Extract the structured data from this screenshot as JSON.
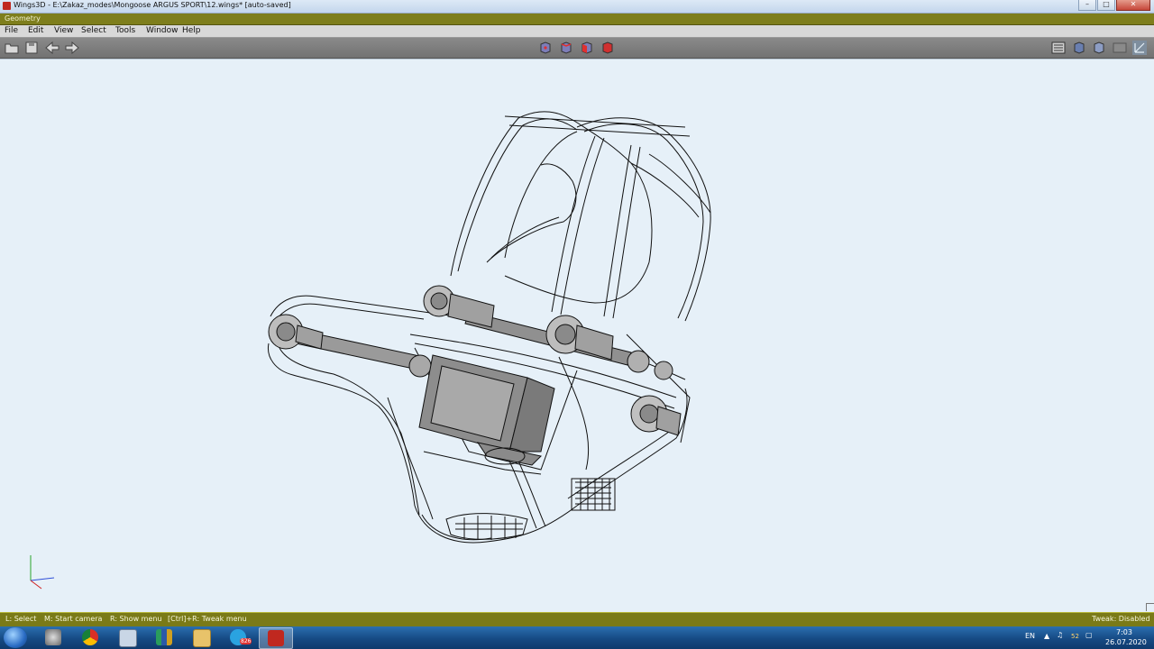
{
  "window": {
    "title": "Wings3D - E:\\Zakaz_modes\\Mongoose ARGUS SPORT\\12.wings* [auto-saved]",
    "controls": [
      "minimize",
      "maximize",
      "close"
    ]
  },
  "geometry_bar": {
    "label": "Geometry"
  },
  "menu": [
    "File",
    "Edit",
    "View",
    "Select",
    "Tools",
    "Window",
    "Help"
  ],
  "toolbar": {
    "left_icons": [
      "open-file-icon",
      "save-file-icon",
      "undo-arrow-icon",
      "redo-arrow-icon"
    ],
    "selection_modes": [
      "vertex-mode-icon",
      "edge-mode-icon",
      "face-mode-icon",
      "body-mode-icon"
    ],
    "right_icons": [
      "outliner-icon",
      "smooth-shade-icon",
      "flat-shade-icon",
      "wireframe-icon",
      "axes-icon"
    ]
  },
  "statusbar": {
    "hint_select": "L: Select",
    "hint_camera": "M: Start camera",
    "hint_menu": "R: Show menu",
    "hint_tweak": "[Ctrl]+R: Tweak menu",
    "tweak_state": "Tweak: Disabled"
  },
  "taskbar": {
    "apps": [
      "start-orb-icon",
      "search-app-icon",
      "chrome-icon",
      "calculator-icon",
      "books-app-icon",
      "explorer-folder-icon",
      "telegram-icon",
      "wings3d-icon"
    ],
    "telegram_badge": "826",
    "language": "EN",
    "volume": "52",
    "time": "7:03",
    "date": "26.07.2020"
  },
  "colors": {
    "viewport_bg": "#e6f0f8",
    "geometry_bar": "#7e7e1c",
    "statusbar": "#7a7a18",
    "body_mode": "#d03030"
  }
}
